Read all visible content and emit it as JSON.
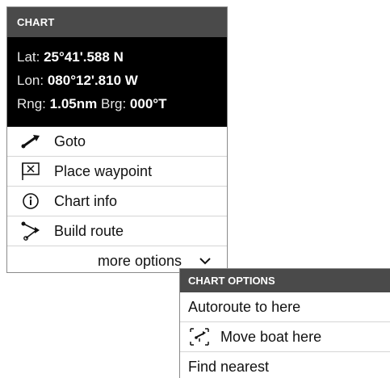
{
  "menu": {
    "title": "CHART",
    "lat_label": "Lat:",
    "lat_value": "25°41'.588 N",
    "lon_label": "Lon:",
    "lon_value": "080°12'.810 W",
    "rng_label": "Rng:",
    "rng_value": "1.05nm",
    "brg_label": "Brg:",
    "brg_value": "000°T",
    "items": [
      {
        "label": "Goto",
        "icon": "goto-arrow-icon"
      },
      {
        "label": "Place waypoint",
        "icon": "waypoint-flag-icon"
      },
      {
        "label": "Chart info",
        "icon": "info-icon"
      },
      {
        "label": "Build route",
        "icon": "route-icon"
      }
    ],
    "more_label": "more options",
    "more_icon": "chevron-down-icon"
  },
  "submenu": {
    "title": "CHART OPTIONS",
    "items": [
      {
        "label": "Autoroute to here"
      },
      {
        "label": "Move boat here",
        "icon": "move-boat-icon"
      },
      {
        "label": "Find nearest"
      }
    ]
  }
}
